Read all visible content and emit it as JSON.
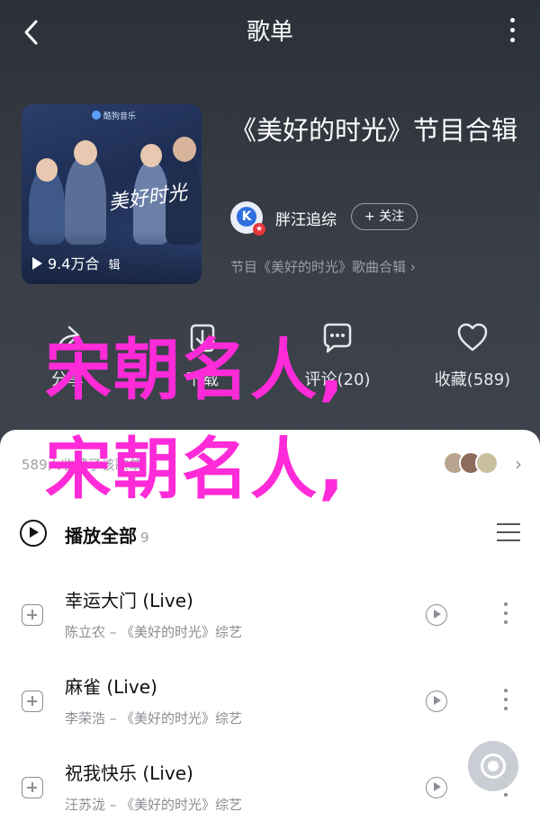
{
  "nav": {
    "title": "歌单"
  },
  "cover": {
    "brand": "酷狗音乐",
    "script_text": "美好时光",
    "play_count": "9.4万合",
    "play_count_suffix": "辑"
  },
  "album": {
    "title": "《美好的时光》节目合辑",
    "creator_name": "胖汪追综",
    "follow_label": "+ 关注",
    "subtitle": "节目《美好的时光》歌曲合辑 ›"
  },
  "actions": [
    {
      "label": "分享",
      "icon": "share-icon"
    },
    {
      "label": "下载",
      "icon": "download-icon"
    },
    {
      "label": "评论(20)",
      "icon": "comment-icon"
    },
    {
      "label": "收藏(589)",
      "icon": "heart-icon"
    }
  ],
  "comment_row": {
    "text": "589人收藏了该歌单"
  },
  "play_all": {
    "label": "播放全部",
    "count": "9"
  },
  "songs": [
    {
      "title": "幸运大门 (Live)",
      "meta": "陈立农 – 《美好的时光》综艺"
    },
    {
      "title": "麻雀 (Live)",
      "meta": "李荣浩 – 《美好的时光》综艺"
    },
    {
      "title": "祝我快乐 (Live)",
      "meta": "汪苏泷 – 《美好的时光》综艺"
    }
  ],
  "watermark": {
    "line1": "宋朝名人,",
    "line2": "宋朝名人,"
  },
  "colors": {
    "header_bg": "#33383f",
    "watermark": "#ff2ad8"
  }
}
